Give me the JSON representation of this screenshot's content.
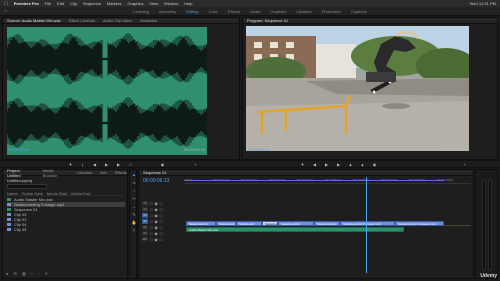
{
  "mac_menu": {
    "app_name": "Premiere Pro",
    "items": [
      "File",
      "Edit",
      "Clip",
      "Sequence",
      "Markers",
      "Graphics",
      "View",
      "Window",
      "Help"
    ],
    "right_status": "Wed 12:31 PM"
  },
  "workspaces": {
    "items": [
      "Learning",
      "Assembly",
      "Editing",
      "Color",
      "Effects",
      "Audio",
      "Graphics",
      "Libraries",
      "Production",
      "Captions"
    ],
    "active_index": 2
  },
  "source_monitor": {
    "tabs": [
      "Source: Audio Master Mix.wav",
      "Effect Controls",
      "Audio Clip Mixer",
      "Metadata"
    ],
    "timecode": "00:00:00:00",
    "duration": "00:00:09:18",
    "waveform_color": "#2f8f6f"
  },
  "program_monitor": {
    "tabs": [
      "Program: Sequence 01"
    ],
    "timecode": "00:00:06:13",
    "duration": "00:00:10:00"
  },
  "project_panel": {
    "tabs": [
      "Project: Untitled",
      "Media Browser",
      "Libraries",
      "Info",
      "Effects"
    ],
    "project_name": "Untitled.prproj",
    "columns": [
      "Name",
      "Frame Rate",
      "Media Start",
      "Media End"
    ],
    "items": [
      {
        "name": "Audio Master Mix.wav",
        "color": "#2e8f6c",
        "selected": false
      },
      {
        "name": "Skateboarding Footage.mp4",
        "color": "#6f8fd6",
        "selected": true
      },
      {
        "name": "Sequence 01",
        "color": "#2e8f6c",
        "selected": false
      },
      {
        "name": "Clip 02",
        "color": "#6f8fd6",
        "selected": false
      },
      {
        "name": "Clip 03",
        "color": "#6f8fd6",
        "selected": false
      },
      {
        "name": "Clip 04",
        "color": "#6f8fd6",
        "selected": false
      },
      {
        "name": "Clip 05",
        "color": "#6f8fd6",
        "selected": false
      }
    ]
  },
  "timeline": {
    "tab": "Sequence 01",
    "timecode": "00:00:06:13",
    "ruler_ticks": [
      "00:00",
      "00:00:01:00",
      "00:00:02:00",
      "00:00:03:00",
      "00:00:04:00",
      "00:00:05:00",
      "00:00:06:00",
      "00:00:07:00",
      "00:00:08:00",
      "00:00:09:00"
    ],
    "tracks": [
      "V3",
      "V2",
      "V1",
      "A1",
      "A2",
      "A3",
      "Mix"
    ],
    "video_clips": [
      "Skateboarding Footage.mp4",
      "Skateboarding",
      "Skateboard",
      "Skateboarding",
      "Skateboarding",
      "Skateboarding Footage",
      "Skateboarding Footage.mp4",
      "Skateboarding Footage.mp4"
    ],
    "audio_clip": "Audio Master Mix.wav"
  },
  "watermark": "Udemy",
  "colors": {
    "accent": "#4aa3ff",
    "video_clip": "#6f8fd6",
    "audio_clip": "#2e8f6c"
  }
}
